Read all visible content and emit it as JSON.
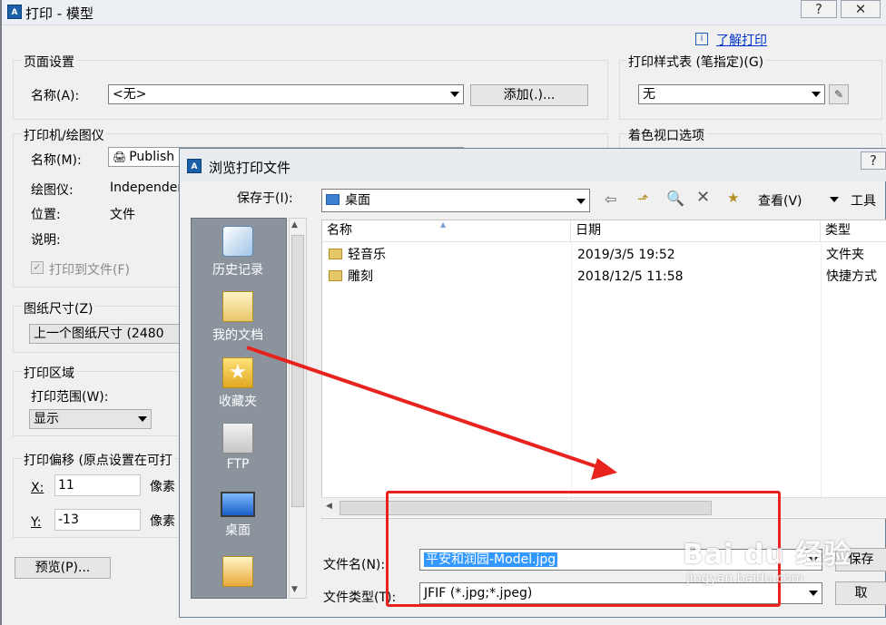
{
  "outer_window": {
    "title": "打印 - 模型",
    "help_button": "?",
    "close_button": "✕",
    "help_link": "了解打印",
    "page_setup": {
      "group_label": "页面设置",
      "name_label": "名称(A):",
      "name_value": "<无>",
      "add_button": "添加(.)..."
    },
    "printer": {
      "group_label": "打印机/绘图仪",
      "name_label": "名称(M):",
      "name_value": "Publish",
      "plotter_label": "绘图仪:",
      "plotter_value": "Independer",
      "location_label": "位置:",
      "location_value": "文件",
      "description_label": "说明:",
      "print_to_file_label": "打印到文件(F)"
    },
    "paper_size": {
      "group_label": "图纸尺寸(Z)",
      "value": "上一个图纸尺寸  (2480"
    },
    "plot_area": {
      "group_label": "打印区域",
      "range_label": "打印范围(W):",
      "range_value": "显示"
    },
    "plot_offset": {
      "group_label": "打印偏移 (原点设置在可打",
      "x_label": "X:",
      "x_value": "11",
      "x_unit": "像素",
      "y_label": "Y:",
      "y_value": "-13",
      "y_unit": "像素"
    },
    "preview_button": "预览(P)...",
    "plot_style_table": {
      "group_label": "打印样式表 (笔指定)(G)",
      "value": "无"
    },
    "shaded_viewport": {
      "group_label": "着色视口选项"
    }
  },
  "browse_dialog": {
    "title": "浏览打印文件",
    "help_button": "?",
    "save_in_label": "保存于(I):",
    "save_in_value": "桌面",
    "view_menu": "查看(V)",
    "tools_menu": "工具",
    "places": [
      "历史记录",
      "我的文档",
      "收藏夹",
      "FTP",
      "桌面"
    ],
    "columns": {
      "name": "名称",
      "date": "日期",
      "type": "类型"
    },
    "files": [
      {
        "name": "轻音乐",
        "date": "2019/3/5 19:52",
        "type": "文件夹"
      },
      {
        "name": "雕刻",
        "date": "2018/12/5 11:58",
        "type": "快捷方式"
      }
    ],
    "filename_label": "文件名(N):",
    "filename_value": "平安和润园-Model.jpg",
    "filetype_label": "文件类型(T):",
    "filetype_value": "JFIF (*.jpg;*.jpeg)",
    "save_button": "保存",
    "cancel_button": "取"
  },
  "watermark": {
    "brand": "Bai du 经验",
    "url": "jingyan.baidu.com"
  },
  "colors": {
    "annotation_red": "#e8231e",
    "selection_blue": "#3399ff",
    "places_bar": "#8b949c"
  }
}
